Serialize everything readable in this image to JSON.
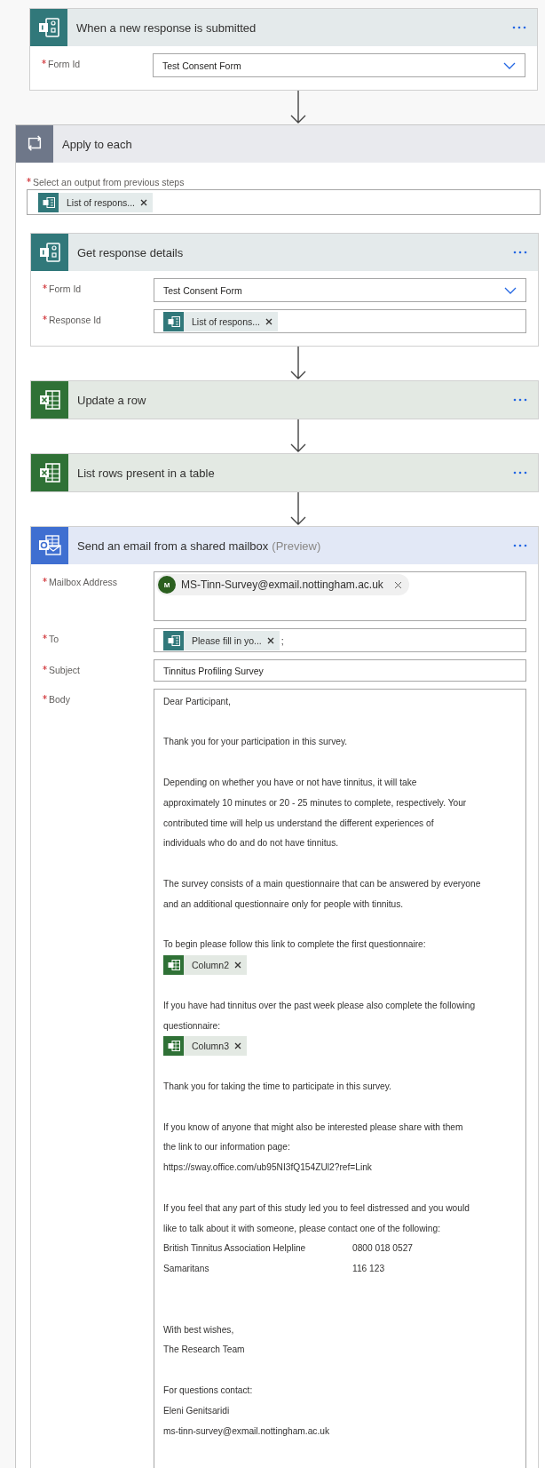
{
  "trigger": {
    "kind": "forms",
    "title": "When a new response is submitted",
    "fields": [
      {
        "label": "Form Id",
        "required": true,
        "kind": "dropdown",
        "value": "Test Consent Form"
      }
    ]
  },
  "apply_to_each": {
    "title": "Apply to each",
    "output_label": "Select an output from previous steps",
    "output_required": true,
    "output_token": {
      "kind": "forms",
      "label": "List of respons..."
    },
    "steps": [
      {
        "kind": "forms",
        "title": "Get response details",
        "fields": [
          {
            "label": "Form Id",
            "required": true,
            "kind": "dropdown",
            "value": "Test Consent Form"
          },
          {
            "label": "Response Id",
            "required": true,
            "kind": "tokens",
            "tokens": [
              {
                "kind": "forms",
                "label": "List of respons..."
              }
            ]
          }
        ]
      },
      {
        "kind": "excel",
        "title": "Update a row"
      },
      {
        "kind": "excel",
        "title": "List rows present in a table"
      },
      {
        "kind": "outlook",
        "title": "Send an email from a shared mailbox",
        "suffix": "(Preview)",
        "fields": [
          {
            "label": "Mailbox Address",
            "required": true,
            "kind": "recipient",
            "avatar": "M",
            "value": "MS-Tinn-Survey@exmail.nottingham.ac.uk"
          },
          {
            "label": "To",
            "required": true,
            "kind": "tokens",
            "tokens": [
              {
                "kind": "forms",
                "label": "Please fill in yo..."
              }
            ],
            "separator": ";"
          },
          {
            "label": "Subject",
            "required": true,
            "kind": "text",
            "value": "Tinnitus Profiling Survey"
          },
          {
            "label": "Body",
            "required": true,
            "kind": "body",
            "lines": [
              {
                "kind": "text",
                "text": "Dear Participant,"
              },
              {
                "kind": "blank"
              },
              {
                "kind": "text",
                "text": "Thank you for your participation in this survey."
              },
              {
                "kind": "blank"
              },
              {
                "kind": "text",
                "text": "Depending on whether you have or not have tinnitus, it will take"
              },
              {
                "kind": "text",
                "text": "approximately 10 minutes or 20 - 25 minutes to complete, respectively. Your"
              },
              {
                "kind": "text",
                "text": "contributed time will help us understand the different experiences of"
              },
              {
                "kind": "text",
                "text": "individuals who do and do not have tinnitus."
              },
              {
                "kind": "blank"
              },
              {
                "kind": "text",
                "text": "The survey consists of a main questionnaire that can be answered by everyone"
              },
              {
                "kind": "text",
                "text": "and an additional questionnaire only for people with tinnitus."
              },
              {
                "kind": "blank"
              },
              {
                "kind": "text",
                "text": "To begin please follow this link to complete the first questionnaire:"
              },
              {
                "kind": "token",
                "token": {
                  "kind": "excel",
                  "label": "Column2"
                }
              },
              {
                "kind": "blank"
              },
              {
                "kind": "text",
                "text": "If you have had tinnitus over the past week please also complete the following"
              },
              {
                "kind": "text",
                "text": "questionnaire:"
              },
              {
                "kind": "token",
                "token": {
                  "kind": "excel",
                  "label": "Column3"
                }
              },
              {
                "kind": "blank"
              },
              {
                "kind": "text",
                "text": "Thank you for taking the time to participate in this survey."
              },
              {
                "kind": "blank"
              },
              {
                "kind": "text",
                "text": "If you know of anyone that might also be interested please share with them"
              },
              {
                "kind": "text",
                "text": "the link to our information page:"
              },
              {
                "kind": "text",
                "text": "https://sway.office.com/ub95NI3fQ154ZUl2?ref=Link"
              },
              {
                "kind": "blank"
              },
              {
                "kind": "text",
                "text": "If you feel that any part of this study led you to feel distressed and you would"
              },
              {
                "kind": "text",
                "text": "like to talk about it with someone, please contact one of the following:"
              },
              {
                "kind": "contact",
                "name": "British Tinnitus Association Helpline",
                "phone": "0800 018 0527"
              },
              {
                "kind": "contact",
                "name": "Samaritans",
                "phone": "116 123"
              },
              {
                "kind": "blank"
              },
              {
                "kind": "blank"
              },
              {
                "kind": "text",
                "text": "With best wishes,"
              },
              {
                "kind": "text",
                "text": "The Research Team"
              },
              {
                "kind": "blank"
              },
              {
                "kind": "text",
                "text": "For questions contact:"
              },
              {
                "kind": "text",
                "text": "Eleni Genitsaridi"
              },
              {
                "kind": "text",
                "text": "ms-tinn-survey@exmail.nottingham.ac.uk"
              }
            ]
          }
        ]
      }
    ]
  }
}
